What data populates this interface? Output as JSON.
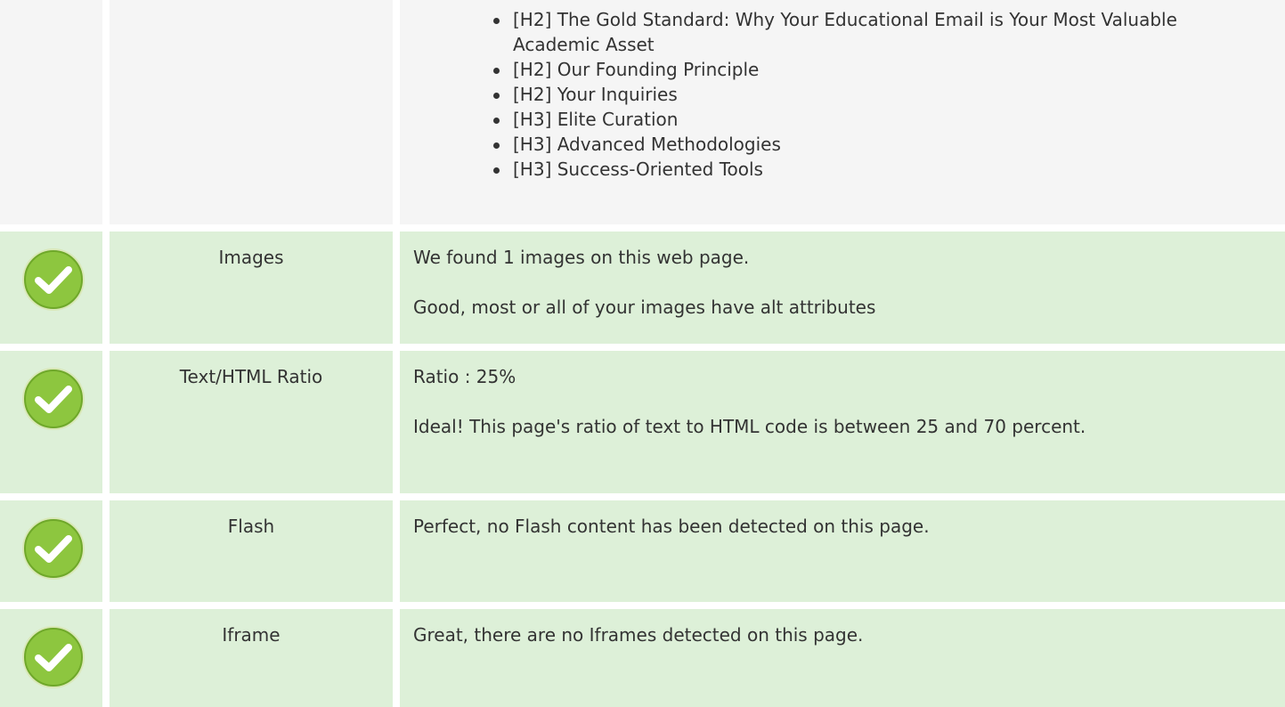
{
  "headings": {
    "items": [
      "[H2] The Gold Standard: Why Your Educational Email is Your Most Valuable Academic Asset",
      "[H2] Our Founding Principle",
      "[H2] Your Inquiries",
      "[H3] Elite Curation",
      "[H3] Advanced Methodologies",
      "[H3] Success-Oriented Tools"
    ]
  },
  "rows": [
    {
      "name": "Images",
      "lines": [
        "We found 1 images on this web page.",
        "Good, most or all of your images have alt attributes"
      ]
    },
    {
      "name": "Text/HTML Ratio",
      "lines": [
        "Ratio : 25%",
        "Ideal! This page's ratio of text to HTML code is between 25 and 70 percent."
      ]
    },
    {
      "name": "Flash",
      "lines": [
        "Perfect, no Flash content has been detected on this page."
      ]
    },
    {
      "name": "Iframe",
      "lines": [
        "Great, there are no Iframes detected on this page."
      ]
    }
  ],
  "colors": {
    "ok_row": "#ddf0d8",
    "plain_row": "#f5f5f5",
    "check_green": "#8dc63f"
  },
  "icons": {
    "status": "check-circle-icon"
  }
}
